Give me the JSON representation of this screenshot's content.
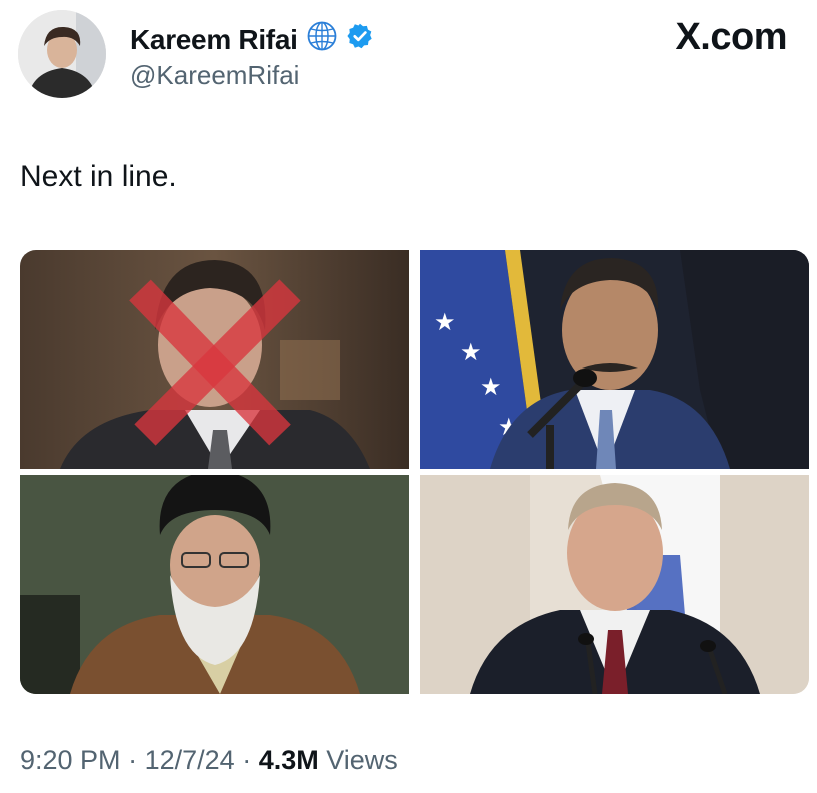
{
  "author": {
    "display_name": "Kareem Rifai",
    "handle": "@KareemRifai",
    "affiliation_icon": "globe-icon",
    "verified_icon": "verified-badge-icon",
    "verified_color": "#1d9bf0"
  },
  "site_label": "X.com",
  "tweet": {
    "text": "Next in line."
  },
  "media": [
    {
      "subject": "man in dark suit with red X mark over face",
      "marked_out": true
    },
    {
      "subject": "man with mustache at microphone in front of blue flag with stars"
    },
    {
      "subject": "elderly man in black turban and brown robe with white beard"
    },
    {
      "subject": "man in dark suit with burgundy tie in front of white and blue flag"
    }
  ],
  "meta": {
    "time": "9:20 PM",
    "separator": "·",
    "date": "12/7/24",
    "views_count": "4.3M",
    "views_label": "Views"
  },
  "colors": {
    "text_primary": "#0f1419",
    "text_secondary": "#536471",
    "x_mark": "#d9363e"
  }
}
